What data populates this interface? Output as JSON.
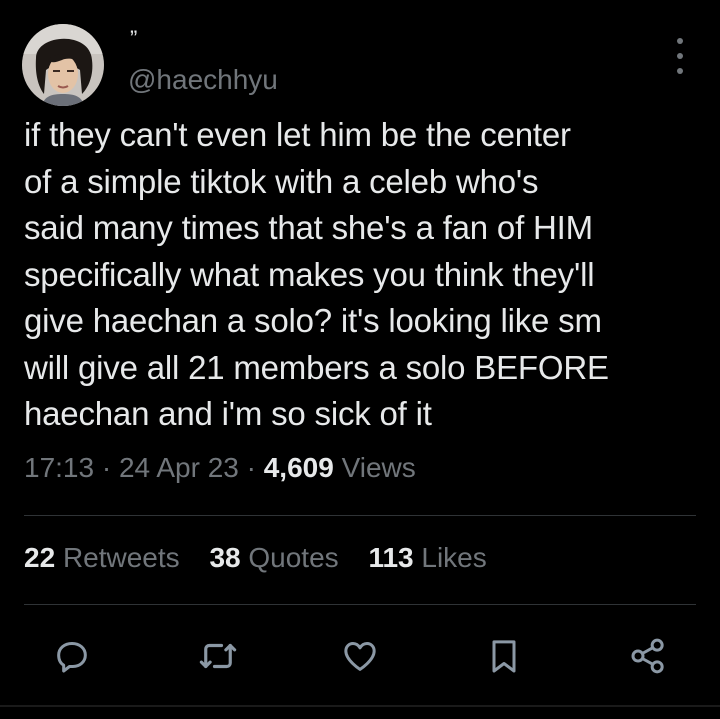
{
  "colors": {
    "background": "#000000",
    "text_primary": "#e7e9ea",
    "text_secondary": "#71767b",
    "divider": "#2f3336"
  },
  "author": {
    "display_name": "”",
    "handle": "@haechhyu",
    "avatar_icon": "profile-photo"
  },
  "tweet": {
    "text": "if they can't even let him be the center\nof a simple tiktok with a celeb who's\nsaid many times that she's a fan of HIM\nspecifically what makes you think they'll\ngive haechan a solo? it's looking like sm\nwill give all 21 members a solo BEFORE\nhaechan and i'm so sick of it",
    "time": "17:13",
    "separator": "·",
    "date": "24 Apr 23",
    "views_count": "4,609",
    "views_label": "Views"
  },
  "stats": {
    "retweets_count": "22",
    "retweets_label": "Retweets",
    "quotes_count": "38",
    "quotes_label": "Quotes",
    "likes_count": "113",
    "likes_label": "Likes"
  },
  "actions": {
    "reply_icon": "reply-icon",
    "retweet_icon": "retweet-icon",
    "like_icon": "heart-icon",
    "bookmark_icon": "bookmark-icon",
    "share_icon": "share-icon"
  }
}
